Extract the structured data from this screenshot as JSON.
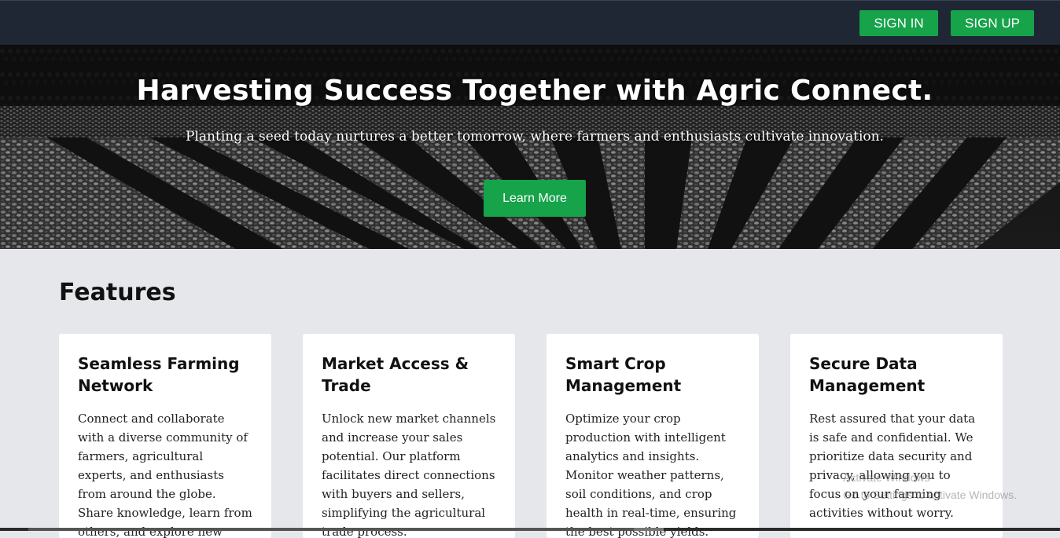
{
  "nav": {
    "sign_in": "SIGN IN",
    "sign_up": "SIGN UP"
  },
  "hero": {
    "title": "Harvesting Success Together with Agric Connect.",
    "subtitle": "Planting a seed today nurtures a better tomorrow, where farmers and enthusiasts cultivate innovation.",
    "cta": "Learn More"
  },
  "features": {
    "title": "Features",
    "cards": [
      {
        "title": "Seamless Farming Network",
        "text": "Connect and collaborate with a diverse community of farmers, agricultural experts, and enthusiasts from around the globe. Share knowledge, learn from others, and explore new opportunities."
      },
      {
        "title": "Market Access & Trade",
        "text": "Unlock new market channels and increase your sales potential. Our platform facilitates direct connections with buyers and sellers, simplifying the agricultural trade process."
      },
      {
        "title": "Smart Crop Management",
        "text": "Optimize your crop production with intelligent analytics and insights. Monitor weather patterns, soil conditions, and crop health in real-time, ensuring the best possible yields."
      },
      {
        "title": "Secure Data Management",
        "text": "Rest assured that your data is safe and confidential. We prioritize data security and privacy, allowing you to focus on your farming activities without worry."
      }
    ]
  },
  "watermark": {
    "line1": "Activate Windows",
    "line2": "Go to Settings to activate Windows."
  },
  "colors": {
    "topbar": "#1f2735",
    "accent_green": "#16a34a",
    "page_background": "#e6e7ea",
    "card_background": "#ffffff"
  }
}
